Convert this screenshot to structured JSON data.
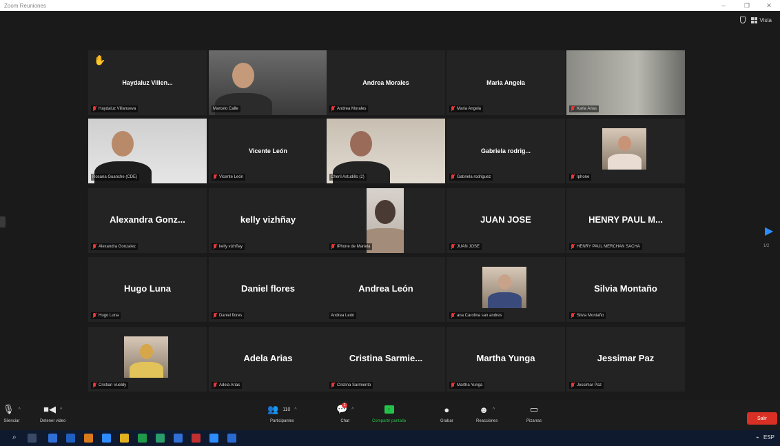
{
  "window": {
    "title": "Zoom Reuniones"
  },
  "top_right": {
    "view_label": "Vista"
  },
  "page_indicator": "1/2",
  "participants": [
    {
      "display": "Haydaluz  Villen...",
      "label": "Haydaluz Villanueva",
      "muted": true,
      "hand": true,
      "video": false
    },
    {
      "display": "",
      "label": "Marcelo Calle",
      "muted": false,
      "video": true
    },
    {
      "display": "Andrea Morales",
      "label": "Andrea Morales",
      "muted": true,
      "video": false
    },
    {
      "display": "Maria Angela",
      "label": "Maria Angela",
      "muted": true,
      "video": false
    },
    {
      "display": "",
      "label": "Karla Arias",
      "muted": true,
      "video": true
    },
    {
      "display": "",
      "label": "Rosana Guanche (CDE)",
      "muted": false,
      "video": true,
      "speaking": true
    },
    {
      "display": "Vicente León",
      "label": "Vicente León",
      "muted": true,
      "video": false
    },
    {
      "display": "",
      "label": "Cheril Astudillo (2)",
      "muted": false,
      "video": true
    },
    {
      "display": "Gabriela  rodrig...",
      "label": "Gabriela rodriguez",
      "muted": true,
      "video": false
    },
    {
      "display": "",
      "label": "Iphone",
      "muted": true,
      "video": true
    },
    {
      "display": "Alexandra  Gonz...",
      "label": "Alexandra Gonzalez",
      "muted": true,
      "video": false
    },
    {
      "display": "kelly vizhñay",
      "label": "kelly vizhñay",
      "muted": true,
      "video": false
    },
    {
      "display": "",
      "label": "iPhone de Mariela",
      "muted": true,
      "video": true
    },
    {
      "display": "JUAN JOSE",
      "label": "JUAN JOSE",
      "muted": true,
      "video": false
    },
    {
      "display": "HENRY PAUL M...",
      "label": "HENRY PAUL MERCHAN SACHA",
      "muted": true,
      "video": false
    },
    {
      "display": "Hugo Luna",
      "label": "Hugo Luna",
      "muted": true,
      "video": false
    },
    {
      "display": "Daniel flores",
      "label": "Daniel flores",
      "muted": true,
      "video": false
    },
    {
      "display": "Andrea León",
      "label": "Andrea León",
      "muted": false,
      "video": false
    },
    {
      "display": "",
      "label": "ana Carolina san andres",
      "muted": true,
      "video": true
    },
    {
      "display": "Silvia Montaño",
      "label": "Silvia Montaño",
      "muted": true,
      "video": false
    },
    {
      "display": "",
      "label": "Cristian Vueldy",
      "muted": true,
      "video": true
    },
    {
      "display": "Adela Arias",
      "label": "Adela Arias",
      "muted": true,
      "video": false
    },
    {
      "display": "Cristina  Sarmie...",
      "label": "Cristina Sarmiento",
      "muted": true,
      "video": false
    },
    {
      "display": "Martha Yunga",
      "label": "Martha Yunga",
      "muted": true,
      "video": false
    },
    {
      "display": "Jessimar Paz",
      "label": "Jessimar Paz",
      "muted": true,
      "video": false
    }
  ],
  "toolbar": {
    "mute_label": "Silenciar",
    "video_label": "Detener video",
    "participants_label": "Participantes",
    "participants_count": "110",
    "chat_label": "Chat",
    "chat_badge": "2",
    "share_label": "Compartir pantalla",
    "record_label": "Grabar",
    "reactions_label": "Reacciones",
    "whiteboard_label": "Pizarras",
    "leave_label": "Salir"
  },
  "taskbar": {
    "lang": "ESP"
  }
}
